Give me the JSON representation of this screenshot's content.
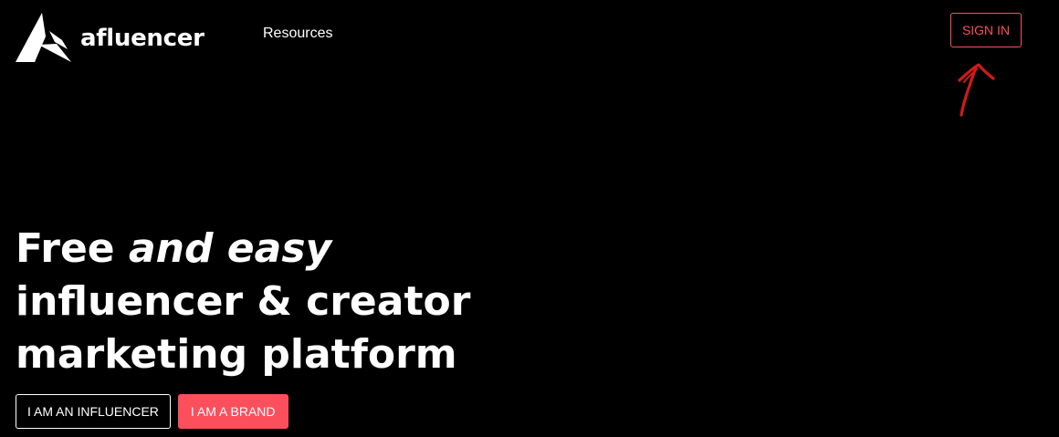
{
  "brand": {
    "name": "afluencer",
    "logo_icon": "triangle-logo-icon"
  },
  "nav": {
    "resources_label": "Resources",
    "sign_in_label": "SIGN IN"
  },
  "annotation": {
    "arrow_icon": "hand-drawn-arrow-icon",
    "arrow_color": "#d11a1a"
  },
  "hero": {
    "line1_plain": "Free ",
    "line1_italic": "and easy",
    "line2": "influencer & creator",
    "line3": "marketing platform"
  },
  "cta": {
    "influencer_label": "I AM AN INFLUENCER",
    "brand_label": "I AM A BRAND"
  },
  "colors": {
    "background": "#000000",
    "accent": "#fb4f5c",
    "text": "#ffffff"
  }
}
